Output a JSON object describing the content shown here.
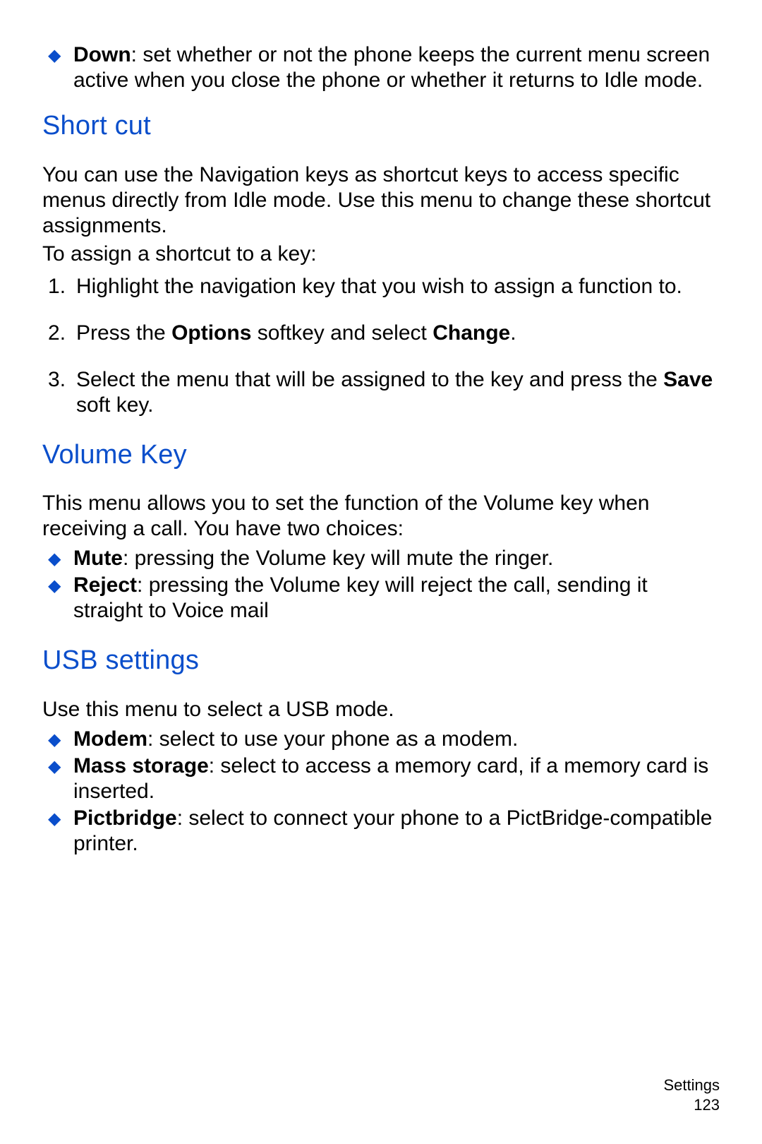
{
  "intro_bullets": [
    {
      "term": "Down",
      "desc": ": set whether or not the phone keeps the current menu screen active when you close the phone or whether it returns to Idle mode."
    }
  ],
  "shortcut": {
    "heading": "Short cut",
    "intro1": "You can use the Navigation keys as shortcut keys to access specific menus directly from Idle mode. Use this menu to change these shortcut assignments.",
    "intro2": "To assign a shortcut to a key:",
    "steps": {
      "s1": "Highlight the navigation key that you wish to assign a function to.",
      "s2p1": "Press the ",
      "s2b1": "Options",
      "s2p2": " softkey and select ",
      "s2b2": "Change",
      "s2p3": ".",
      "s3p1": "Select the menu that will be assigned to the key and press the ",
      "s3b1": "Save",
      "s3p2": " soft key."
    }
  },
  "volume": {
    "heading": "Volume Key",
    "intro": "This menu allows you to set the function of the Volume key when receiving a call. You have two choices:",
    "bullets": [
      {
        "term": "Mute",
        "desc": ": pressing the Volume key will mute the ringer."
      },
      {
        "term": "Reject",
        "desc": ": pressing the Volume key will reject the call, sending it straight to Voice mail"
      }
    ]
  },
  "usb": {
    "heading": "USB settings",
    "intro": "Use this menu to select a USB mode.",
    "bullets": [
      {
        "term": "Modem",
        "desc": ": select to use your phone as a modem."
      },
      {
        "term": "Mass storage",
        "desc": ": select to access a memory card, if a memory card is inserted."
      },
      {
        "term": "Pictbridge",
        "desc": ": select to connect your phone to a PictBridge-compatible printer."
      }
    ]
  },
  "footer": {
    "section": "Settings",
    "page": "123"
  }
}
